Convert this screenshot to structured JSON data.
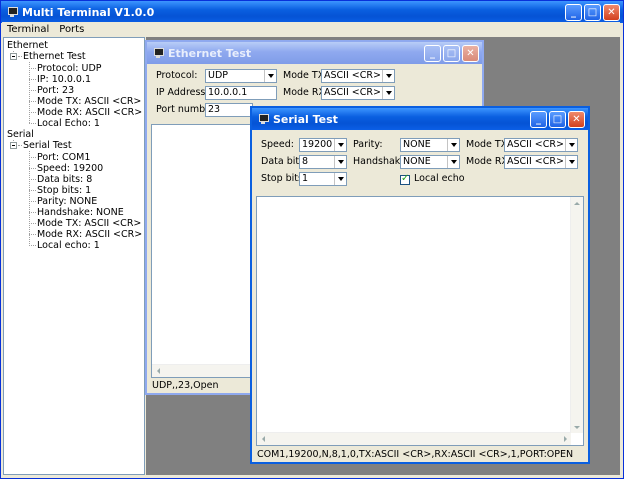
{
  "app": {
    "title": "Multi Terminal V1.0.0",
    "menu": [
      "Terminal",
      "Ports"
    ]
  },
  "tree": {
    "ethernet_root": "Ethernet",
    "ethernet_test": "Ethernet Test",
    "ethernet_children": [
      "Protocol: UDP",
      "IP: 10.0.0.1",
      "Port: 23",
      "Mode TX: ASCII <CR>",
      "Mode RX: ASCII <CR>",
      "Local Echo: 1"
    ],
    "serial_root": "Serial",
    "serial_test": "Serial Test",
    "serial_children": [
      "Port: COM1",
      "Speed: 19200",
      "Data bits: 8",
      "Stop bits: 1",
      "Parity: NONE",
      "Handshake: NONE",
      "Mode TX: ASCII <CR>",
      "Mode RX: ASCII <CR>",
      "Local echo: 1"
    ]
  },
  "ethernet_window": {
    "title": "Ethernet Test",
    "protocol_label": "Protocol:",
    "protocol_value": "UDP",
    "ip_label": "IP Address:",
    "ip_value": "10.0.0.1",
    "port_label": "Port number:",
    "port_value": "23",
    "mode_tx_label": "Mode TX:",
    "mode_tx_value": "ASCII <CR>",
    "mode_rx_label": "Mode RX:",
    "mode_rx_value": "ASCII <CR>",
    "status": "UDP,,23,Open"
  },
  "serial_window": {
    "title": "Serial Test",
    "speed_label": "Speed:",
    "speed_value": "19200",
    "databits_label": "Data bits:",
    "databits_value": "8",
    "stopbits_label": "Stop bits:",
    "stopbits_value": "1",
    "parity_label": "Parity:",
    "parity_value": "NONE",
    "handshake_label": "Handshake:",
    "handshake_value": "NONE",
    "mode_tx_label": "Mode TX:",
    "mode_tx_value": "ASCII <CR>",
    "mode_rx_label": "Mode RX:",
    "mode_rx_value": "ASCII <CR>",
    "local_echo_label": "Local echo",
    "local_echo_checked": true,
    "status": "COM1,19200,N,8,1,0,TX:ASCII <CR>,RX:ASCII <CR>,1,PORT:OPEN"
  },
  "window_buttons": {
    "minimize": "_",
    "maximize": "□",
    "close": "✕"
  },
  "colors": {
    "titlebar_active": "#0553d5",
    "titlebar_inactive": "#8fa9ef",
    "mdi_background": "#808080",
    "window_face": "#ece9d8"
  }
}
